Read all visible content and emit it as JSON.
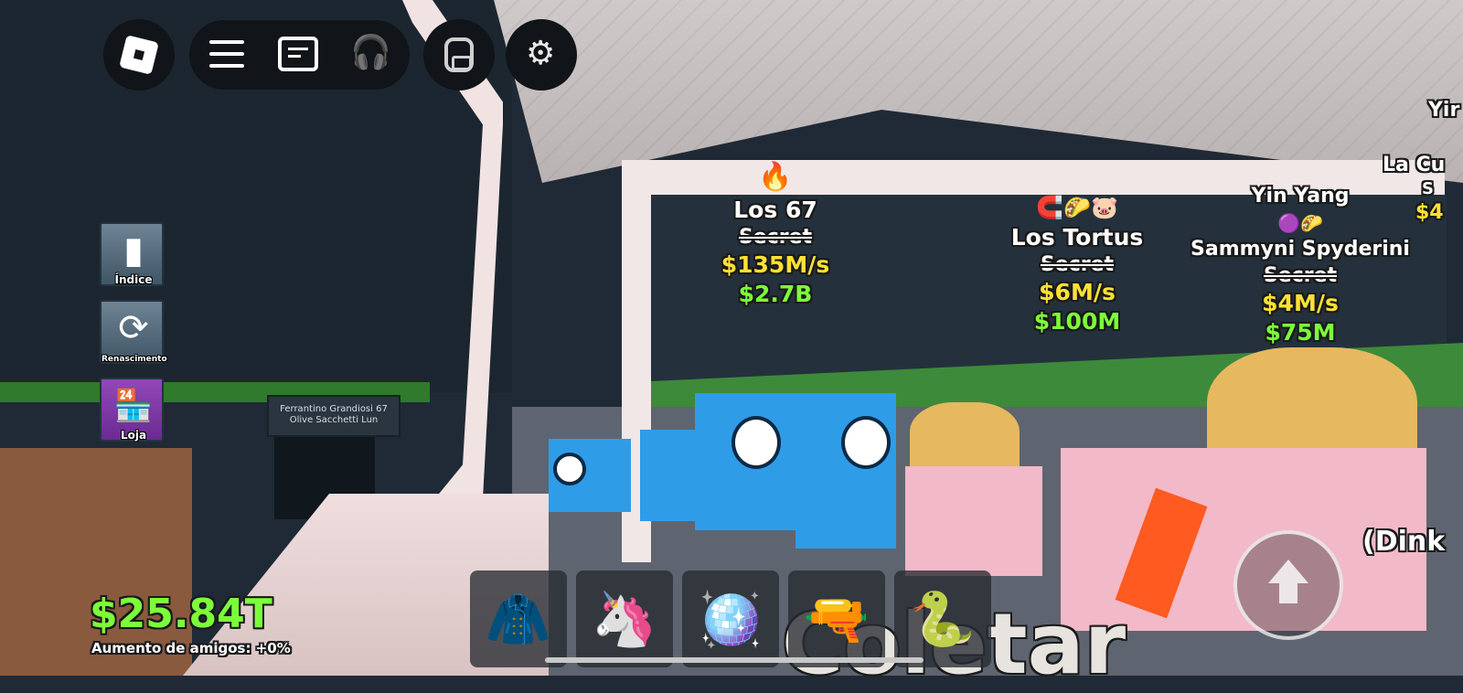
{
  "topbar": {
    "roblox_icon": "roblox-logo-icon",
    "menu_icon": "hamburger-menu-icon",
    "chat_icon": "chat-icon",
    "voice_icon": "headphones-icon",
    "backpack_icon": "backpack-icon",
    "settings_icon": "gear-icon"
  },
  "side_buttons": [
    {
      "label": "Índice",
      "icon": "book-icon"
    },
    {
      "label": "Renascimento",
      "icon": "rebirth-icon"
    },
    {
      "label": "Loja",
      "icon": "shop-icon"
    }
  ],
  "brainrots": [
    {
      "name": "Los 67",
      "rarity": "Secret",
      "rate": "$135M/s",
      "price": "$2.7B"
    },
    {
      "name": "Los Tortus",
      "rarity": "Secret",
      "rate": "$6M/s",
      "price": "$100M"
    },
    {
      "name": "Sammyni Spyderini",
      "rarity": "Secret",
      "rate": "$4M/s",
      "price": "$75M",
      "tag": "Yin Yang"
    }
  ],
  "edge_labels": {
    "right_top": "Yir",
    "right_name": "La Cu",
    "right_rarity": "S",
    "right_rate": "$4",
    "right_bottom": "(Dink"
  },
  "hud": {
    "money": "$25.84T",
    "friends_boost": "Aumento de amigos: +0%",
    "collect_label": "Coletar"
  },
  "hotbar": [
    {
      "item": "invisibility-cloak-icon",
      "glyph": "🧥"
    },
    {
      "item": "rainbow-sword-icon",
      "glyph": "🦄"
    },
    {
      "item": "disco-ball-icon",
      "glyph": "🪩"
    },
    {
      "item": "laser-gun-icon",
      "glyph": "🔫"
    },
    {
      "item": "medusa-head-icon",
      "glyph": "🐍"
    }
  ],
  "sign": {
    "text": "Ferrantino Grandiosi 67 Olive Sacchetti Lun"
  },
  "colors": {
    "money": "#7cff3a",
    "rate": "#ffe135",
    "shop": "#7b3aa6",
    "hud_bg": "#111418"
  }
}
